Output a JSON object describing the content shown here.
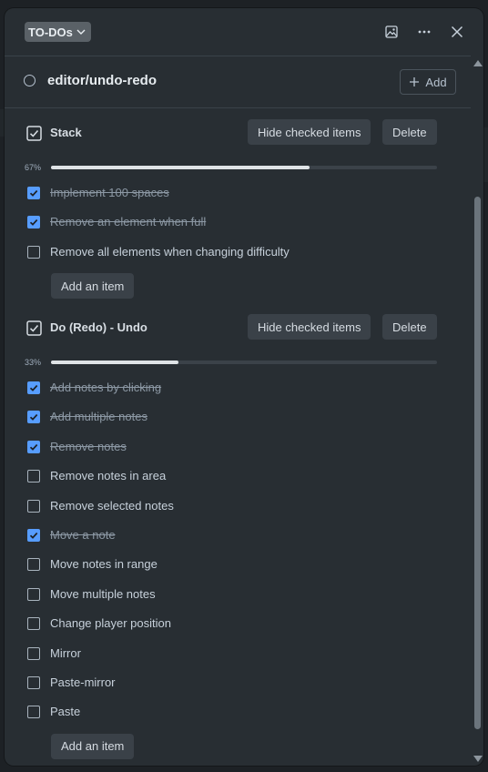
{
  "header": {
    "tag_label": "TO-DOs"
  },
  "card": {
    "title": "editor/undo-redo",
    "add_label": "Add"
  },
  "checklists": [
    {
      "title": "Stack",
      "percent_label": "67%",
      "progress": 0.67,
      "hide_label": "Hide checked items",
      "delete_label": "Delete",
      "add_item_label": "Add an item",
      "items": [
        {
          "text": "Implement 100 spaces",
          "checked": true
        },
        {
          "text": "Remove an element when full",
          "checked": true
        },
        {
          "text": "Remove all elements when changing difficulty",
          "checked": false
        }
      ]
    },
    {
      "title": "Do (Redo) - Undo",
      "percent_label": "33%",
      "progress": 0.33,
      "hide_label": "Hide checked items",
      "delete_label": "Delete",
      "add_item_label": "Add an item",
      "items": [
        {
          "text": "Add notes by clicking",
          "checked": true
        },
        {
          "text": "Add multiple notes",
          "checked": true
        },
        {
          "text": "Remove notes",
          "checked": true
        },
        {
          "text": "Remove notes in area",
          "checked": false
        },
        {
          "text": "Remove selected notes",
          "checked": false
        },
        {
          "text": "Move a note",
          "checked": true
        },
        {
          "text": "Move notes in range",
          "checked": false
        },
        {
          "text": "Move multiple notes",
          "checked": false
        },
        {
          "text": "Change player position",
          "checked": false
        },
        {
          "text": "Mirror",
          "checked": false
        },
        {
          "text": "Paste-mirror",
          "checked": false
        },
        {
          "text": "Paste",
          "checked": false
        }
      ]
    }
  ],
  "colors": {
    "check_on": "#579dff",
    "modal_bg": "#282e33"
  },
  "icons": [
    "chevron-down-icon",
    "image-icon",
    "more-icon",
    "close-icon",
    "plus-icon",
    "checklist-icon",
    "check-icon"
  ]
}
